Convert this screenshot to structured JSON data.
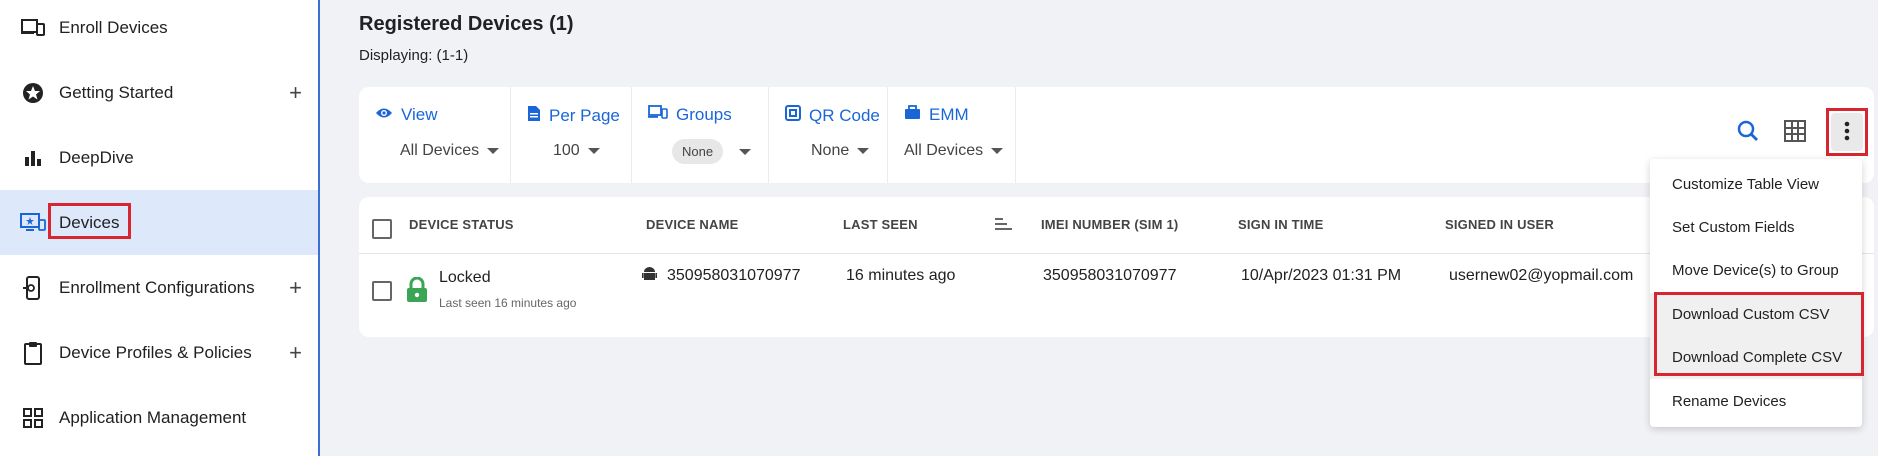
{
  "sidebar": {
    "items": [
      {
        "label": "Enroll Devices",
        "icon": "devices-icon",
        "has_plus": false
      },
      {
        "label": "Getting Started",
        "icon": "star-badge-icon",
        "has_plus": true
      },
      {
        "label": "DeepDive",
        "icon": "bar-chart-icon",
        "has_plus": false
      },
      {
        "label": "Devices",
        "icon": "monitor-icon",
        "has_plus": false,
        "active": true
      },
      {
        "label": "Enrollment Configurations",
        "icon": "phone-settings-icon",
        "has_plus": true
      },
      {
        "label": "Device Profiles & Policies",
        "icon": "clipboard-icon",
        "has_plus": true
      },
      {
        "label": "Application Management",
        "icon": "grid-icon",
        "has_plus": false
      }
    ],
    "plus": "+"
  },
  "header": {
    "title": "Registered Devices (1)",
    "displaying": "Displaying: (1-1)"
  },
  "filters": {
    "view": {
      "label": "View",
      "value": "All Devices"
    },
    "per_page": {
      "label": "Per Page",
      "value": "100"
    },
    "groups": {
      "label": "Groups",
      "value": "None"
    },
    "qr_code": {
      "label": "QR Code",
      "value": "None"
    },
    "emm": {
      "label": "EMM",
      "value": "All Devices"
    }
  },
  "table": {
    "columns": [
      "DEVICE STATUS",
      "DEVICE NAME",
      "LAST SEEN",
      "IMEI NUMBER (SIM 1)",
      "SIGN IN TIME",
      "SIGNED IN USER"
    ],
    "rows": [
      {
        "status": "Locked",
        "status_sub": "Last seen 16 minutes ago",
        "device_name": "350958031070977",
        "last_seen": "16 minutes ago",
        "imei": "350958031070977",
        "sign_in_time": "10/Apr/2023 01:31 PM",
        "signed_in_user": "usernew02@yopmail.com"
      }
    ]
  },
  "menu": {
    "items": [
      "Customize Table View",
      "Set Custom Fields",
      "Move Device(s) to Group",
      "Download Custom CSV",
      "Download Complete CSV",
      "Rename Devices"
    ]
  },
  "colors": {
    "accent": "#1a66d9",
    "highlight": "#d7262f",
    "lock_green": "#3aa655",
    "active_bg": "#dde8fb"
  }
}
